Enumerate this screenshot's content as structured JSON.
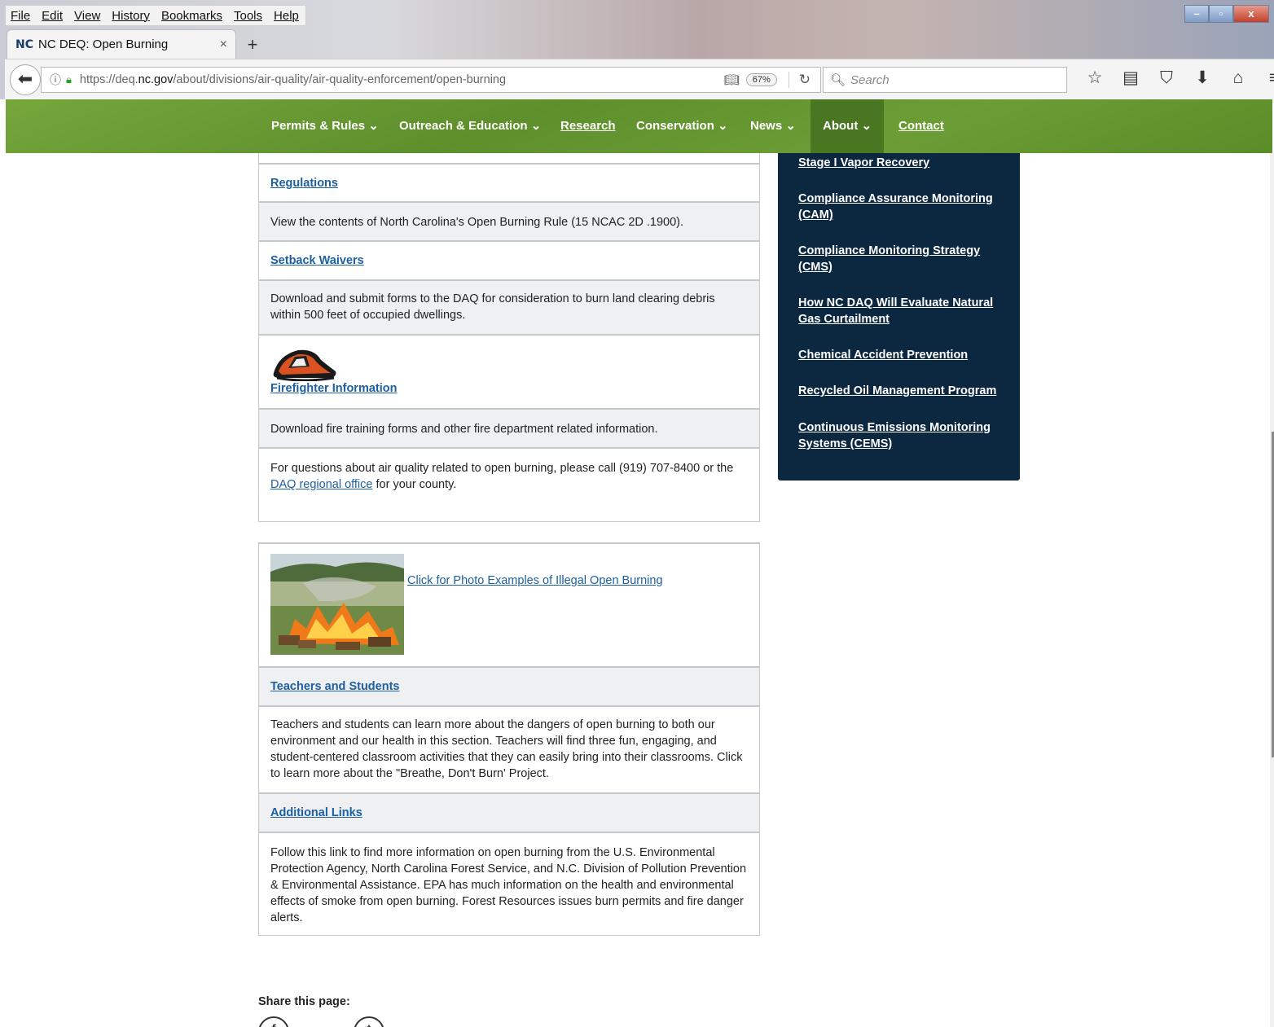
{
  "browser": {
    "menu": [
      "File",
      "Edit",
      "View",
      "History",
      "Bookmarks",
      "Tools",
      "Help"
    ],
    "tab_favicon": "NC",
    "tab_title": "NC DEQ: Open Burning",
    "tab_close": "×",
    "new_tab": "+",
    "url_prefix": "https://deq.",
    "url_domain": "nc.gov",
    "url_path": "/about/divisions/air-quality/air-quality-enforcement/open-burning",
    "zoom": "67%",
    "search_placeholder": "Search",
    "window_controls": [
      "–",
      "▫",
      "x"
    ]
  },
  "nav": {
    "items": [
      {
        "label": "Permits & Rules ⌄"
      },
      {
        "label": "Outreach & Education ⌄"
      },
      {
        "label": "Research"
      },
      {
        "label": "Conservation ⌄"
      },
      {
        "label": "News ⌄"
      },
      {
        "label": "About ⌄"
      },
      {
        "label": "Contact"
      }
    ]
  },
  "content": {
    "regulations_link": "Regulations",
    "regulations_text": "View the contents of North Carolina's Open Burning Rule (15 NCAC 2D .1900).",
    "setback_link": "Setback Waivers",
    "setback_text": "Download and submit forms to the DAQ for consideration to burn land clearing debris within 500 feet of occupied dwellings.",
    "firefighter_link": "Firefighter Information",
    "firefighter_text": "Download fire training forms and other fire department related information.",
    "questions_text_before": "For questions about air quality related to open burning, please call (919) 707-8400 or the",
    "questions_link": "DAQ regional office",
    "questions_text_after": " for your county.",
    "photo_link": "Click for Photo Examples of Illegal Open Burning",
    "teachers_link": "Teachers and Students",
    "teachers_text": "Teachers and students can learn more about the dangers of open burning to both our environment and our health in this section. Teachers will find three fun, engaging, and student-centered classroom activities that they can easily bring into their classrooms. Click to learn more about the \"Breathe, Don't Burn' Project.",
    "additional_link": "Additional Links",
    "additional_text": "Follow this link to find more information on open burning from the U.S. Environmental Protection Agency, North Carolina Forest Service, and N.C. Division of Pollution Prevention & Environmental Assistance. EPA has much information on the health and environmental effects of smoke from open burning. Forest Resources issues burn permits and fire danger alerts."
  },
  "sidebar": {
    "links": [
      "Stage I Vapor Recovery",
      "Compliance Assurance Monitoring (CAM)",
      "Compliance Monitoring Strategy (CMS)",
      "How NC DAQ Will Evaluate Natural Gas Curtailment",
      "Chemical Accident Prevention",
      "Recycled Oil Management Program",
      "Continuous Emissions Monitoring Systems (CEMS)"
    ]
  },
  "share": {
    "label": "Share this page:",
    "icons": [
      "f",
      "t"
    ]
  },
  "colors": {
    "nav_green": "#5d8f2c",
    "sidebar_navy": "#0c2840",
    "link_blue": "#1d5fa3"
  }
}
